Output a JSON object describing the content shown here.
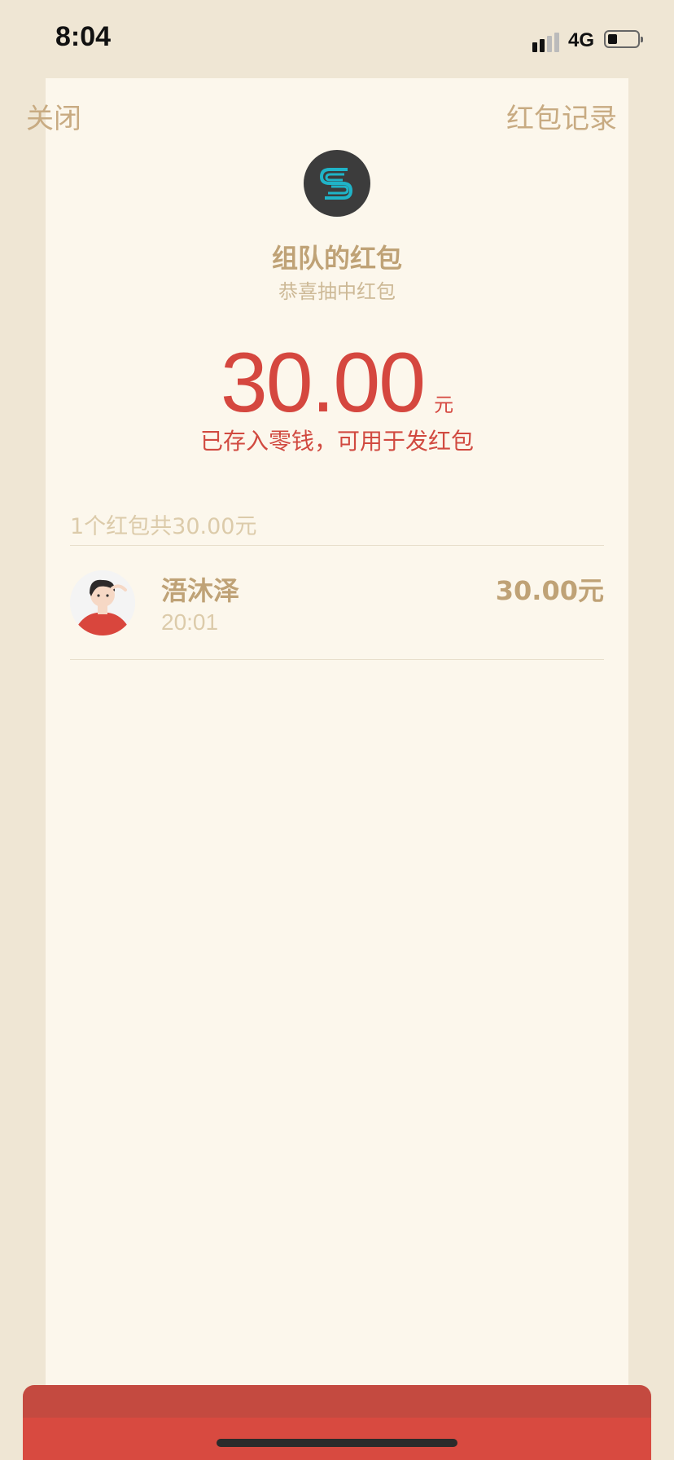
{
  "status_bar": {
    "time": "8:04",
    "network": "4G"
  },
  "nav": {
    "close_label": "关闭",
    "records_label": "红包记录"
  },
  "header": {
    "team_name": "组队的红包",
    "subtitle": "恭喜抽中红包"
  },
  "amount": {
    "value": "30.00",
    "unit": "元",
    "note": "已存入零钱，可用于发红包"
  },
  "summary": {
    "text": "1个红包共30.00元"
  },
  "receivers": [
    {
      "name": "浯沐泽",
      "time": "20:01",
      "amount": "30.00元"
    }
  ],
  "colors": {
    "accent_red": "#d5473f",
    "gold_text": "#bfa276",
    "background": "#fcf7ec"
  },
  "icons": {
    "logo": "team-logo-icon",
    "signal": "signal-icon",
    "battery": "battery-icon"
  }
}
